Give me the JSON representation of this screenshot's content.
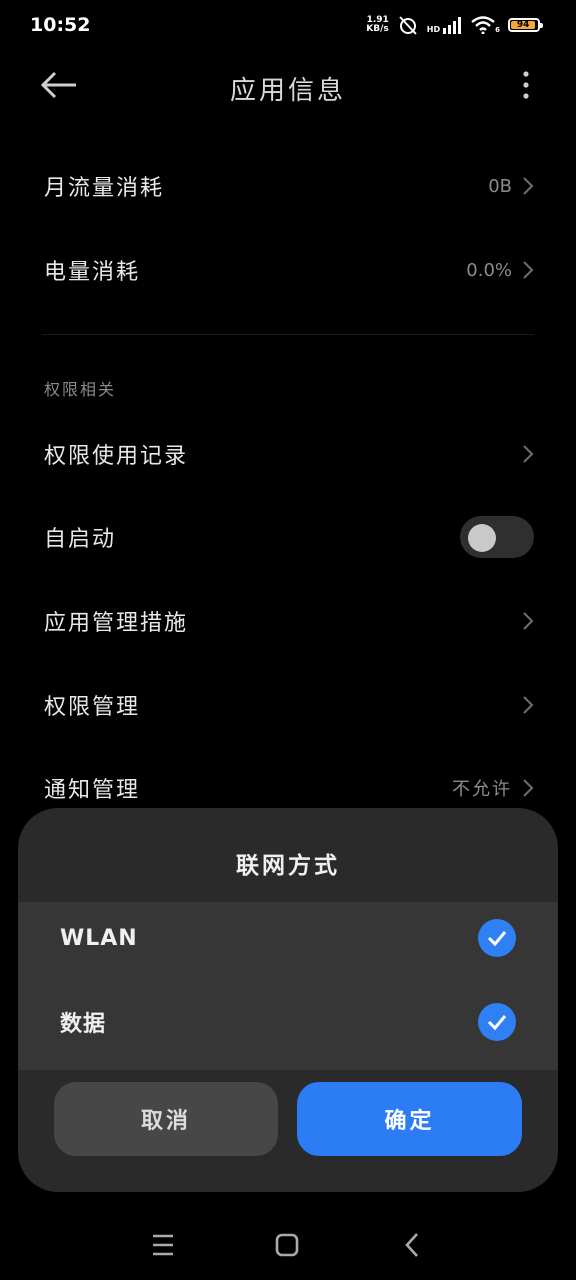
{
  "status_bar": {
    "time": "10:52",
    "net_speed_value": "1.91",
    "net_speed_unit": "KB/s",
    "network_type": "HD",
    "sim_slot": "6",
    "battery": "94",
    "battery_color": "#f0a93a"
  },
  "header": {
    "title": "应用信息"
  },
  "rows": {
    "monthly_data": {
      "label": "月流量消耗",
      "value": "0B"
    },
    "battery_usage": {
      "label": "电量消耗",
      "value": "0.0%"
    },
    "section_permissions": "权限相关",
    "permission_history": {
      "label": "权限使用记录"
    },
    "autostart": {
      "label": "自启动",
      "enabled": false
    },
    "app_management": {
      "label": "应用管理措施"
    },
    "permission_management": {
      "label": "权限管理"
    },
    "notification_management": {
      "label": "通知管理",
      "value": "不允许"
    }
  },
  "dialog": {
    "title": "联网方式",
    "options": [
      {
        "label": "WLAN",
        "checked": true
      },
      {
        "label": "数据",
        "checked": true
      }
    ],
    "cancel_label": "取消",
    "confirm_label": "确定",
    "accent_color": "#2c7cf6"
  },
  "nav_bar": {
    "icons": [
      "menu-icon",
      "home-square-icon",
      "back-chevron-icon"
    ]
  }
}
